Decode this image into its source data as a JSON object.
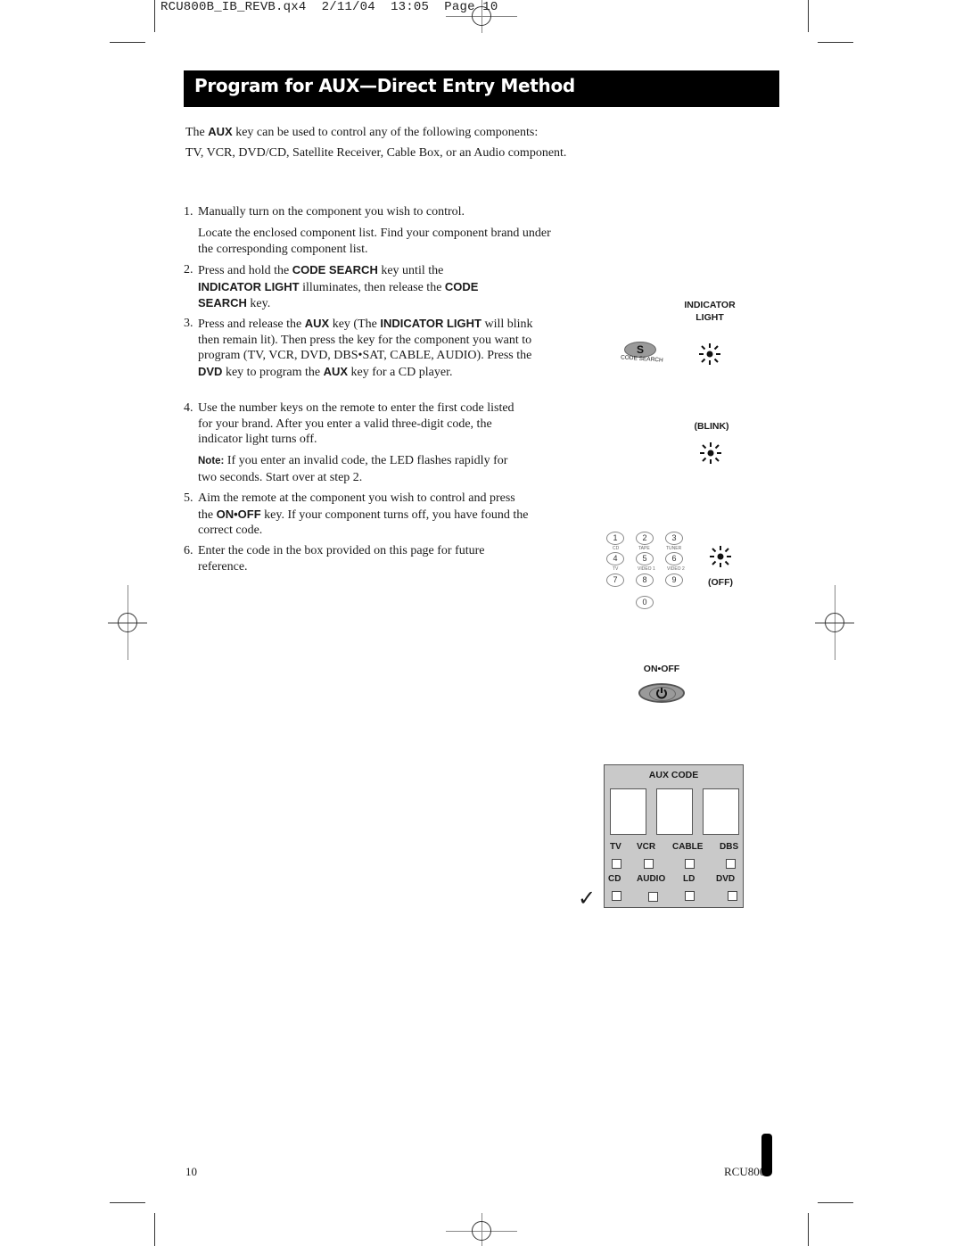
{
  "slug": {
    "filename": "RCU800B_IB_REVB.qx4",
    "date": "2/11/04",
    "time": "13:05",
    "page_label": "Page",
    "page_number": "10"
  },
  "title": "Program for AUX—Direct Entry Method",
  "intro": {
    "line1_pre": "The ",
    "line1_bold": "AUX",
    "line1_post": " key can be used to control any of the following components:",
    "line2": "TV, VCR, DVD/CD, Satellite Receiver, Cable Box, or an Audio component."
  },
  "steps": [
    {
      "number": "1.",
      "text": "Manually turn on the component you wish to control.",
      "sub": "Locate the enclosed component list. Find your component brand under the corresponding component list."
    },
    {
      "number": "2.",
      "parts": [
        "Press and hold the ",
        "CODE SEARCH",
        " key until the ",
        "INDICATOR LIGHT",
        " illuminates, then release the ",
        "CODE SEARCH",
        " key."
      ]
    },
    {
      "number": "3.",
      "parts": [
        "Press and release the ",
        "AUX",
        " key (The ",
        "INDICATOR LIGHT",
        " will blink then remain lit). Then press the key for the component you want to program (TV, VCR, DVD, DBS•SAT, CABLE, AUDIO). Press the ",
        "DVD",
        " key to program the ",
        "AUX",
        " key for a CD player."
      ]
    },
    {
      "number": "4.",
      "text": "Use the number keys on the remote to enter the first code listed for your brand. After you enter a valid three-digit code, the indicator light turns off.",
      "note_label": "Note:",
      "note_text": " If you enter an invalid code, the LED flashes rapidly for two seconds. Start over at step 2."
    },
    {
      "number": "5.",
      "parts": [
        "Aim the remote at the component you wish to control and press the ",
        "ON•OFF",
        " key. If your component turns off, you have found the correct code."
      ]
    },
    {
      "number": "6.",
      "text": "Enter the code in the box provided on this page for future reference."
    }
  ],
  "illustrations": {
    "indicator_light_label": "INDICATOR LIGHT",
    "code_search_key": "S",
    "code_search_caption": "CODE SEARCH",
    "blink_label": "(BLINK)",
    "off_label": "(OFF)",
    "onoff_label": "ON•OFF",
    "keypad": [
      {
        "key": "1",
        "caption": "CD"
      },
      {
        "key": "2",
        "caption": "TAPE"
      },
      {
        "key": "3",
        "caption": "TUNER"
      },
      {
        "key": "4",
        "caption": "TV"
      },
      {
        "key": "5",
        "caption": "VIDEO 1"
      },
      {
        "key": "6",
        "caption": "VIDEO 2"
      },
      {
        "key": "7",
        "caption": ""
      },
      {
        "key": "8",
        "caption": ""
      },
      {
        "key": "9",
        "caption": ""
      },
      {
        "key": "0",
        "caption": ""
      }
    ]
  },
  "code_box": {
    "header": "AUX CODE",
    "digits": [
      "",
      "",
      ""
    ],
    "row1": [
      "TV",
      "VCR",
      "CABLE",
      "DBS"
    ],
    "row2": [
      "CD",
      "AUDIO",
      "LD",
      "DVD"
    ],
    "checkmark": "✓"
  },
  "footer": {
    "page_number": "10",
    "model": "RCU800"
  }
}
